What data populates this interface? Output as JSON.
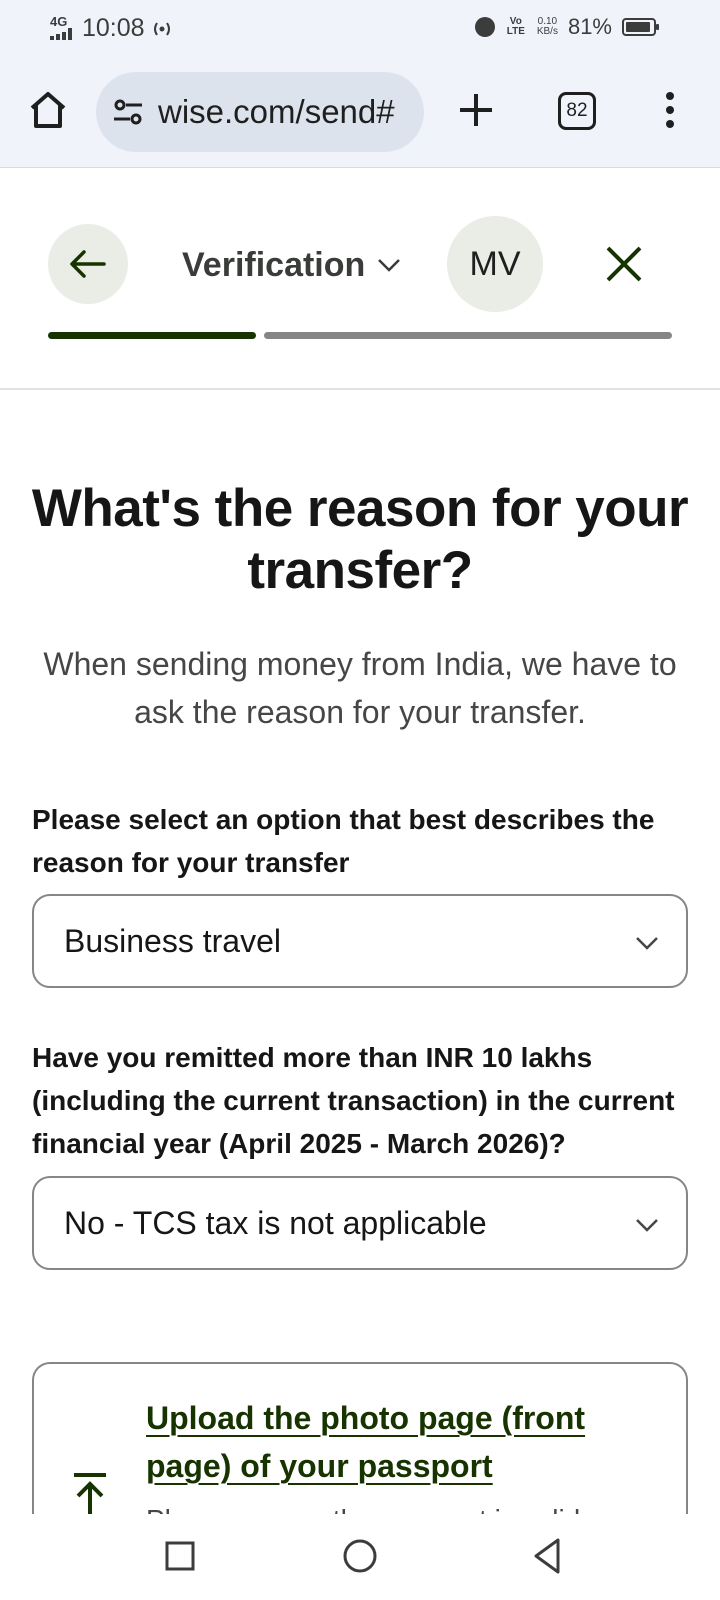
{
  "status_bar": {
    "network": "4G",
    "time": "10:08",
    "volte": "Vo LTE",
    "speed_value": "0.10",
    "speed_unit": "KB/s",
    "battery": "81%"
  },
  "browser": {
    "url": "wise.com/send#",
    "tab_count": "82",
    "icons": [
      "home-icon",
      "site-settings-icon",
      "plus-icon",
      "tabs-icon",
      "more-vert-icon"
    ]
  },
  "header": {
    "step_title": "Verification",
    "avatar_initials": "MV",
    "progress_fraction": 0.33,
    "icons": [
      "arrow-left-icon",
      "chevron-down-icon",
      "close-icon"
    ]
  },
  "main": {
    "title": "What's the reason for your transfer?",
    "subtitle": "When sending money from India, we have to ask the reason for your transfer.",
    "reason_field": {
      "label": "Please select an option that best describes the reason for your transfer",
      "value": "Business travel"
    },
    "remittance_field": {
      "label": "Have you remitted more than INR 10 lakhs (including the current transaction) in the current financial year (April 2025 - March 2026)?",
      "value": "No - TCS tax is not applicable"
    },
    "upload": {
      "link": "Upload the photo page (front page) of your passport",
      "description": "Please ensure the passport is valid"
    }
  },
  "nav_bar": {
    "icons": [
      "recents-square-icon",
      "home-circle-icon",
      "back-triangle-icon"
    ]
  },
  "colors": {
    "brand_dark_green": "#163300",
    "surface_grey": "#eaece6",
    "browser_bg": "#f0f4fa",
    "border_grey": "#868685"
  }
}
